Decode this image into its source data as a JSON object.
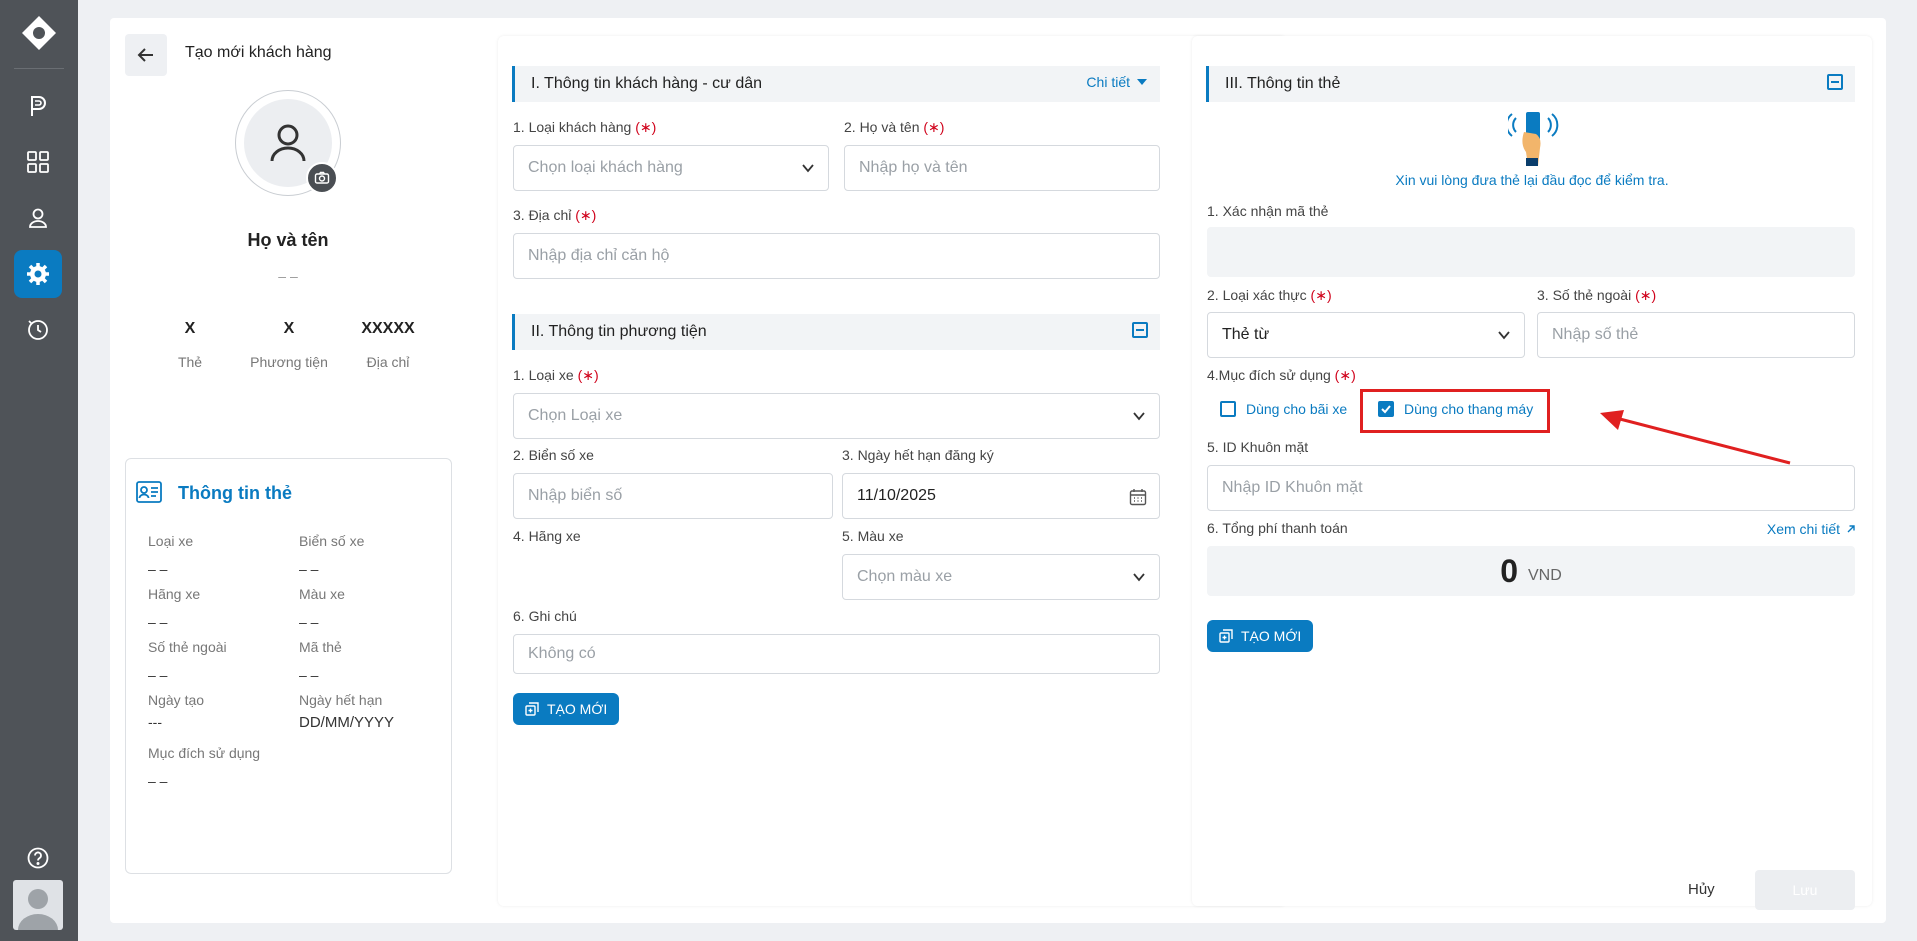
{
  "page": {
    "title": "Tạo mới khách hàng"
  },
  "profile": {
    "name": "Họ và tên",
    "sub": "– –",
    "stats": [
      {
        "value": "X",
        "label": "Thẻ"
      },
      {
        "value": "X",
        "label": "Phương tiện"
      },
      {
        "value": "XXXXX",
        "label": "Địa chỉ"
      }
    ]
  },
  "card_info": {
    "title": "Thông tin thẻ",
    "fields": [
      {
        "label": "Loại xe",
        "value": "– –"
      },
      {
        "label": "Biển số xe",
        "value": "– –"
      },
      {
        "label": "Hãng xe",
        "value": "– –"
      },
      {
        "label": "Màu xe",
        "value": "– –"
      },
      {
        "label": "Số thẻ ngoài",
        "value": "– –"
      },
      {
        "label": "Mã thẻ",
        "value": "– –"
      },
      {
        "label": "Ngày tạo",
        "value": "---"
      },
      {
        "label": "Ngày hết hạn",
        "value": "DD/MM/YYYY"
      },
      {
        "label": "Mục đích sử dụng",
        "value": "– –"
      }
    ]
  },
  "section1": {
    "title": "I. Thông tin khách hàng - cư dân",
    "detail": "Chi tiết",
    "customer_type_label": "1. Loại khách hàng",
    "customer_type_placeholder": "Chọn loại khách hàng",
    "name_label": "2. Họ và tên",
    "name_placeholder": "Nhập họ và tên",
    "address_label": "3. Địa chỉ",
    "address_placeholder": "Nhập địa chỉ căn hộ",
    "required_mark": "(∗)"
  },
  "section2": {
    "title": "II. Thông tin phương tiện",
    "vehicle_type_label": "1. Loại xe",
    "vehicle_type_placeholder": "Chọn Loại xe",
    "plate_label": "2. Biển số xe",
    "plate_placeholder": "Nhập biển số",
    "expiry_label": "3. Ngày hết hạn đăng ký",
    "expiry_value": "11/10/2025",
    "brand_label": "4. Hãng xe",
    "color_label": "5. Màu xe",
    "color_placeholder": "Chọn màu xe",
    "note_label": "6. Ghi chú",
    "note_placeholder": "Không có",
    "create_button": "TẠO MỚI"
  },
  "section3": {
    "title": "III. Thông tin thẻ",
    "reader_hint": "Xin vui lòng đưa thẻ lại đầu đọc để kiểm tra.",
    "confirm_label": "1. Xác nhận mã thẻ",
    "auth_type_label": "2. Loại xác thực",
    "auth_type_value": "Thẻ từ",
    "external_label": "3. Số thẻ ngoài",
    "external_placeholder": "Nhập số thẻ",
    "purpose_label": "4.Mục đích sử dụng",
    "purpose_parking": "Dùng cho bãi xe",
    "purpose_parking_checked": false,
    "purpose_elevator": "Dùng cho thang máy",
    "purpose_elevator_checked": true,
    "face_label": "5. ID Khuôn mặt",
    "face_placeholder": "Nhập ID Khuôn mặt",
    "fee_label": "6. Tổng phí thanh toán",
    "view_detail": "Xem chi tiết",
    "fee_value": "0",
    "fee_unit": "VND",
    "create_button": "TẠO MỚI"
  },
  "footer": {
    "cancel": "Hủy",
    "save": "Lưu"
  },
  "colors": {
    "accent": "#0a7bc1",
    "sidebar": "#4f5358",
    "highlight": "#e02020",
    "required": "#d0021b"
  }
}
